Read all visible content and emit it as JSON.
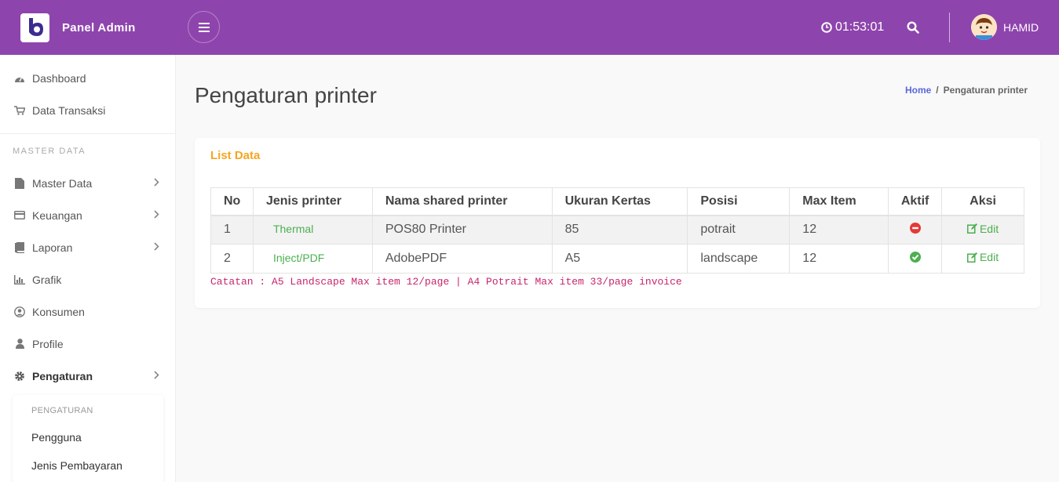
{
  "header": {
    "brand": "Panel Admin",
    "clock": "01:53:01",
    "user_name": "HAMID",
    "colors": {
      "topbar": "#8e44ad"
    }
  },
  "sidebar": {
    "top_items": [
      {
        "label": "Dashboard",
        "icon": "dashboard-icon"
      },
      {
        "label": "Data Transaksi",
        "icon": "cart-icon"
      }
    ],
    "section_title": "MASTER DATA",
    "items": [
      {
        "label": "Master Data",
        "icon": "file-icon"
      },
      {
        "label": "Keuangan",
        "icon": "credit-card-icon"
      },
      {
        "label": "Laporan",
        "icon": "book-icon"
      },
      {
        "label": "Grafik",
        "icon": "bar-chart-icon"
      },
      {
        "label": "Konsumen",
        "icon": "user-circle-icon"
      },
      {
        "label": "Profile",
        "icon": "user-icon"
      },
      {
        "label": "Pengaturan",
        "icon": "gear-icon"
      }
    ],
    "submenu": {
      "title": "PENGATURAN",
      "items": [
        "Pengguna",
        "Jenis Pembayaran"
      ]
    }
  },
  "main": {
    "title": "Pengaturan printer",
    "breadcrumb": {
      "home": "Home",
      "sep": "/",
      "current": "Pengaturan printer"
    },
    "card_title": "List Data",
    "table": {
      "headers": [
        "No",
        "Jenis printer",
        "Nama shared printer",
        "Ukuran Kertas",
        "Posisi",
        "Max Item",
        "Aktif",
        "Aksi"
      ],
      "rows": [
        {
          "no": "1",
          "jenis": "Thermal",
          "nama": "POS80 Printer",
          "ukuran": "85",
          "posisi": "potrait",
          "max": "12",
          "aktif": "inactive",
          "aksi": "Edit"
        },
        {
          "no": "2",
          "jenis": "Inject/PDF",
          "nama": "AdobePDF",
          "ukuran": "A5",
          "posisi": "landscape",
          "max": "12",
          "aktif": "active",
          "aksi": "Edit"
        }
      ]
    },
    "note": "Catatan : A5 Landscape Max item 12/page | A4 Potrait Max item 33/page invoice"
  }
}
